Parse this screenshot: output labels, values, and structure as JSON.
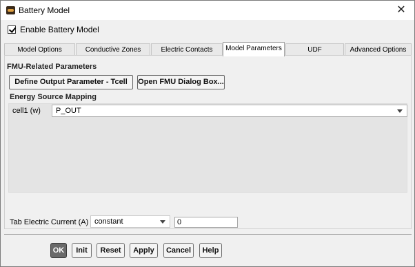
{
  "window": {
    "title": "Battery Model",
    "close_glyph": "✕"
  },
  "enable_checkbox": {
    "label": "Enable Battery Model",
    "checked": true
  },
  "tabs": [
    {
      "label": "Model Options",
      "active": false
    },
    {
      "label": "Conductive Zones",
      "active": false
    },
    {
      "label": "Electric Contacts",
      "active": false
    },
    {
      "label": "Model Parameters",
      "active": true
    },
    {
      "label": "UDF",
      "active": false
    },
    {
      "label": "Advanced Options",
      "active": false
    }
  ],
  "fmu": {
    "section_title": "FMU-Related Parameters",
    "define_output_button": "Define Output Parameter - Tcell",
    "open_fmu_button": "Open FMU Dialog Box..."
  },
  "energy_mapping": {
    "section_title": "Energy Source Mapping",
    "row_label": "cell1 (w)",
    "row_value": "P_OUT"
  },
  "tab_current": {
    "label": "Tab Electric Current (A)",
    "method_value": "constant",
    "value": "0"
  },
  "footer": {
    "ok": "OK",
    "init": "Init",
    "reset": "Reset",
    "apply": "Apply",
    "cancel": "Cancel",
    "help": "Help"
  }
}
